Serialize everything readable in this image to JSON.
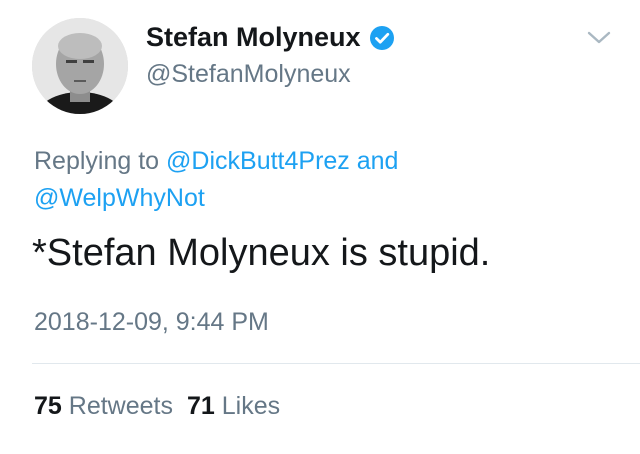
{
  "author": {
    "display_name": "Stefan Molyneux",
    "handle": "@StefanMolyneux",
    "verified": true
  },
  "reply": {
    "prefix": "Replying to",
    "mentions": [
      "@DickButt4Prez",
      "@WelpWhyNot"
    ],
    "conjunction": "and"
  },
  "tweet": {
    "text": "*Stefan Molyneux is stupid.",
    "timestamp": "2018-12-09, 9:44 PM"
  },
  "stats": {
    "retweets_count": "75",
    "retweets_label": "Retweets",
    "likes_count": "71",
    "likes_label": "Likes"
  },
  "icons": {
    "verified": "verified-badge-icon",
    "menu": "chevron-down-icon"
  },
  "colors": {
    "link": "#1da1f2",
    "secondary_text": "#657786",
    "primary_text": "#14171a",
    "divider": "#e1e8ed"
  }
}
